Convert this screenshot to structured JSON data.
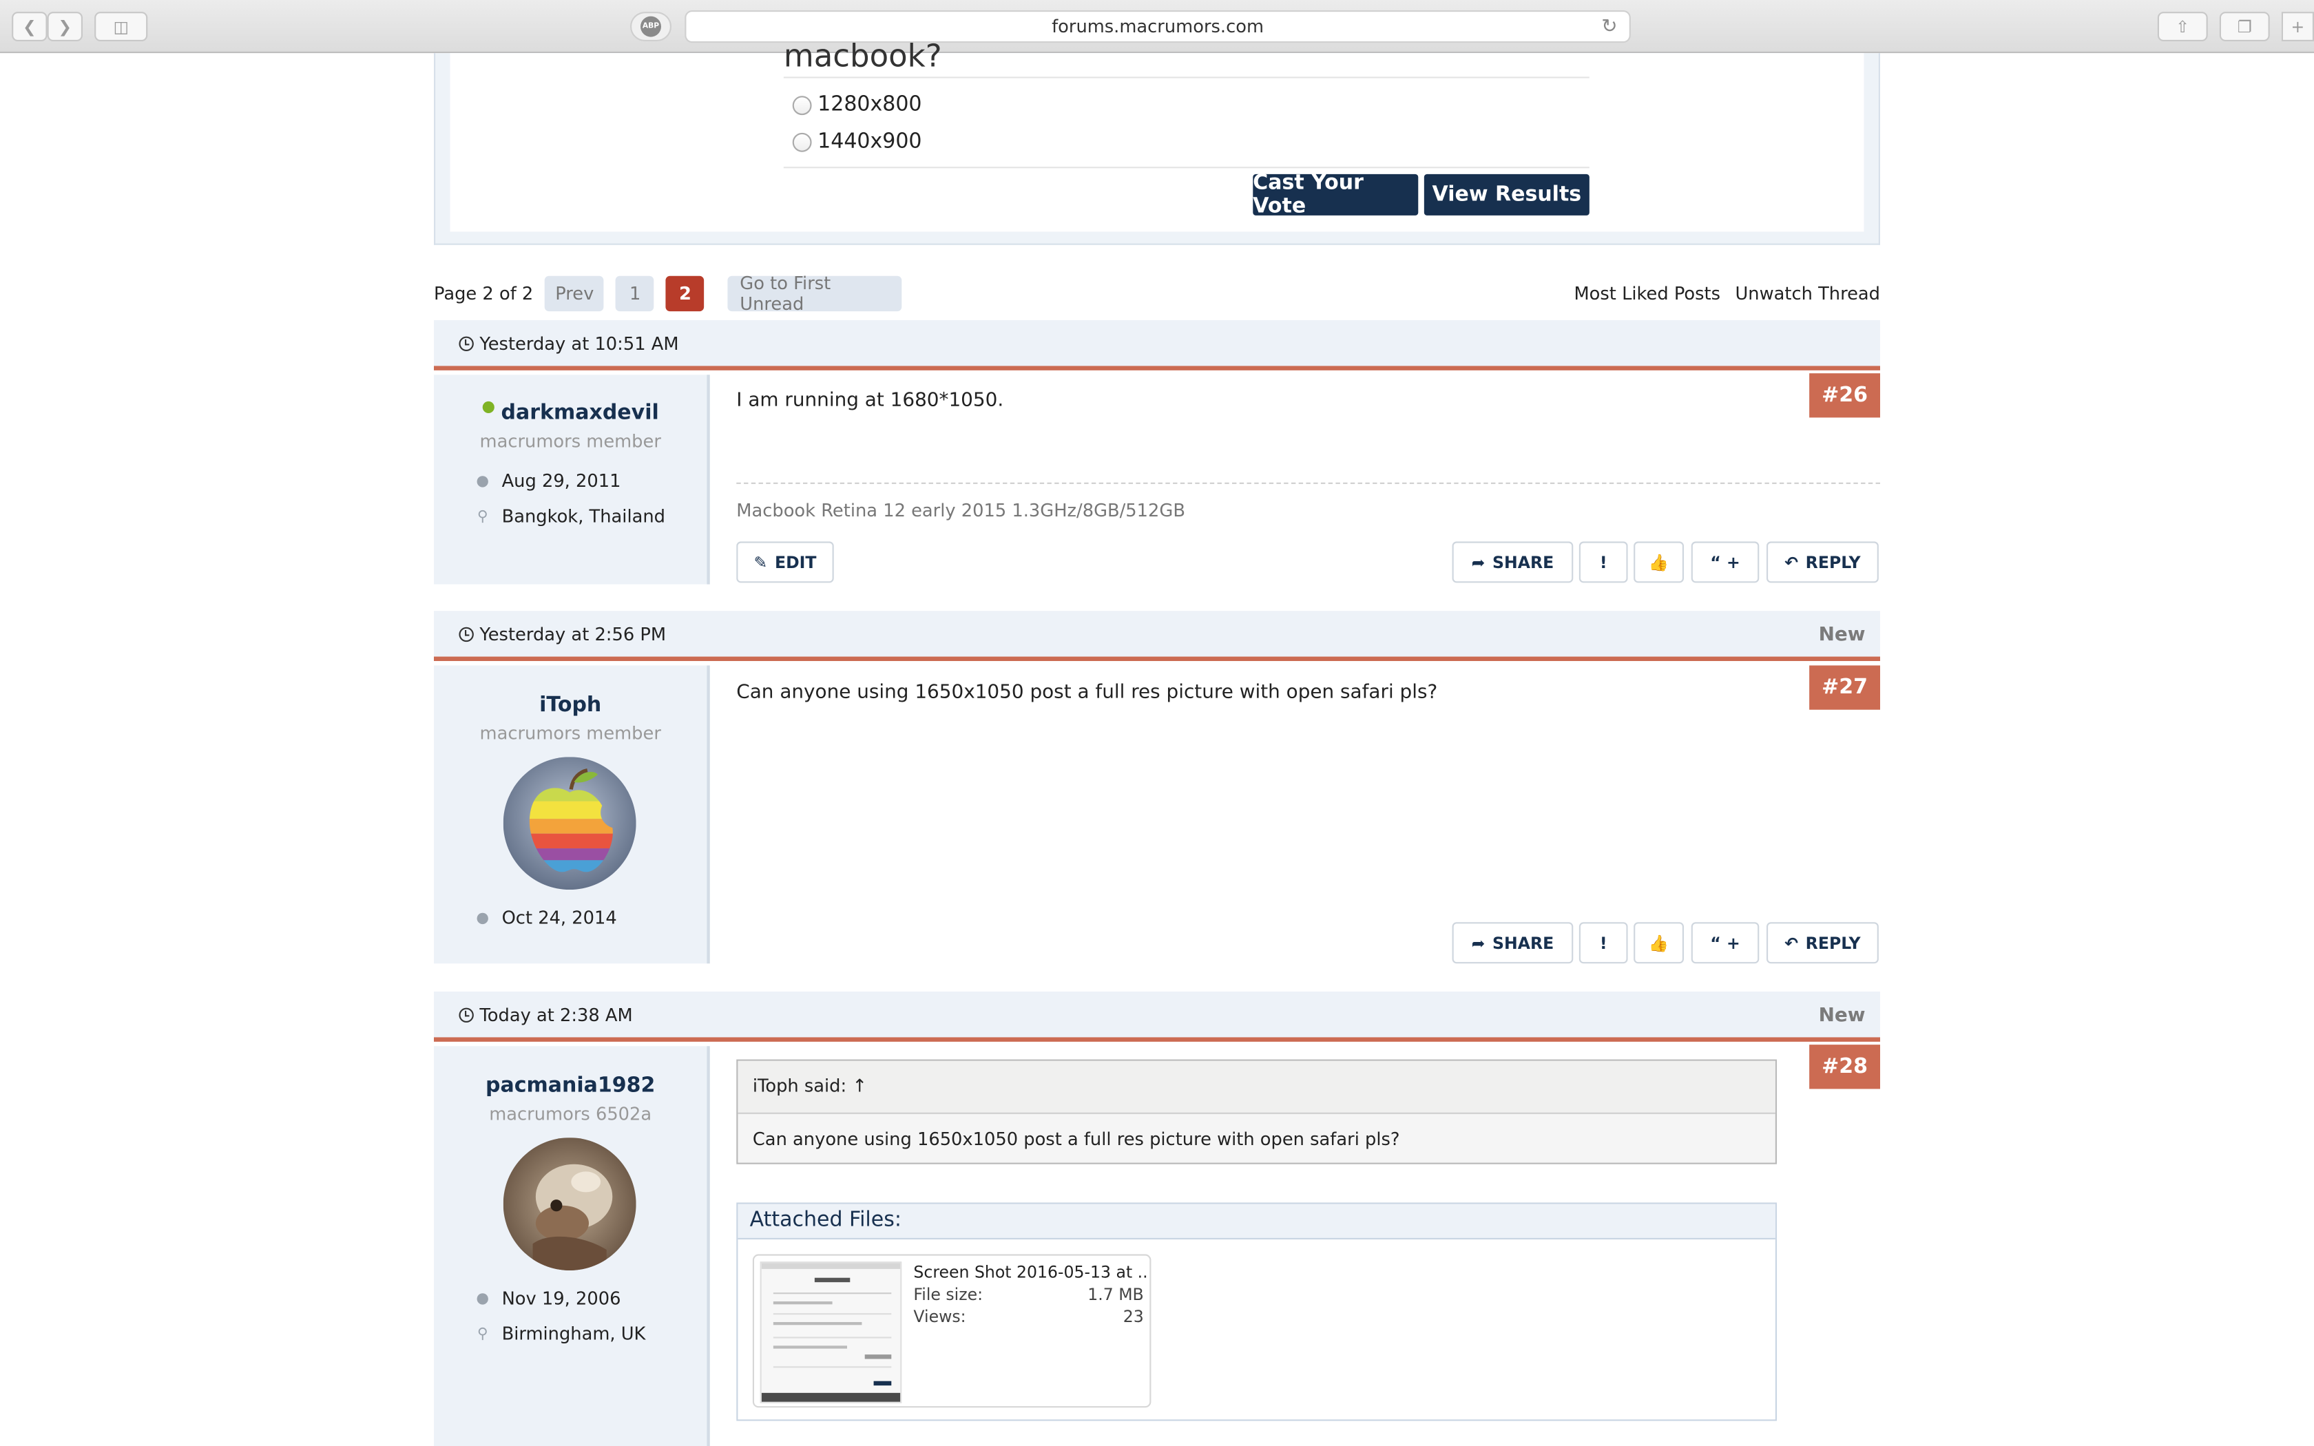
{
  "browser": {
    "url": "forums.macrumors.com",
    "abp_label": "ABP"
  },
  "poll": {
    "question_fragment": "macbook?",
    "options": [
      "1280x800",
      "1440x900"
    ],
    "vote_label": "Cast Your Vote",
    "results_label": "View Results"
  },
  "pagination": {
    "page_text": "Page 2 of 2",
    "prev": "Prev",
    "page1": "1",
    "page2": "2",
    "first_unread": "Go to First Unread",
    "most_liked": "Most Liked Posts",
    "unwatch": "Unwatch Thread"
  },
  "actions": {
    "edit": "EDIT",
    "share": "SHARE",
    "reply": "REPLY",
    "report": "!",
    "like": "👍",
    "multiquote": "“ +"
  },
  "posts": [
    {
      "date": "Yesterday at 10:51 AM",
      "number": "#26",
      "username": "darkmaxdevil",
      "user_title": "macrumors member",
      "joined": "Aug 29, 2011",
      "location": "Bangkok, Thailand",
      "message": "I am running at 1680*1050.",
      "signature": "Macbook Retina 12 early 2015 1.3GHz/8GB/512GB"
    },
    {
      "date": "Yesterday at 2:56 PM",
      "new_label": "New",
      "number": "#27",
      "username": "iToph",
      "user_title": "macrumors member",
      "joined": "Oct 24, 2014",
      "message": "Can anyone using 1650x1050 post a full res picture with open safari pls?"
    },
    {
      "date": "Today at 2:38 AM",
      "new_label": "New",
      "number": "#28",
      "username": "pacmania1982",
      "user_title": "macrumors 6502a",
      "joined": "Nov 19, 2006",
      "location": "Birmingham, UK",
      "quote_head": "iToph said: ↑",
      "quote_body": "Can anyone using 1650x1050 post a full res picture with open safari pls?",
      "attachments_label": "Attached Files:",
      "file_name": "Screen Shot 2016-05-13 at ...",
      "file_size_label": "File size:",
      "file_size": "1.7 MB",
      "views_label": "Views:",
      "views": "23"
    }
  ]
}
